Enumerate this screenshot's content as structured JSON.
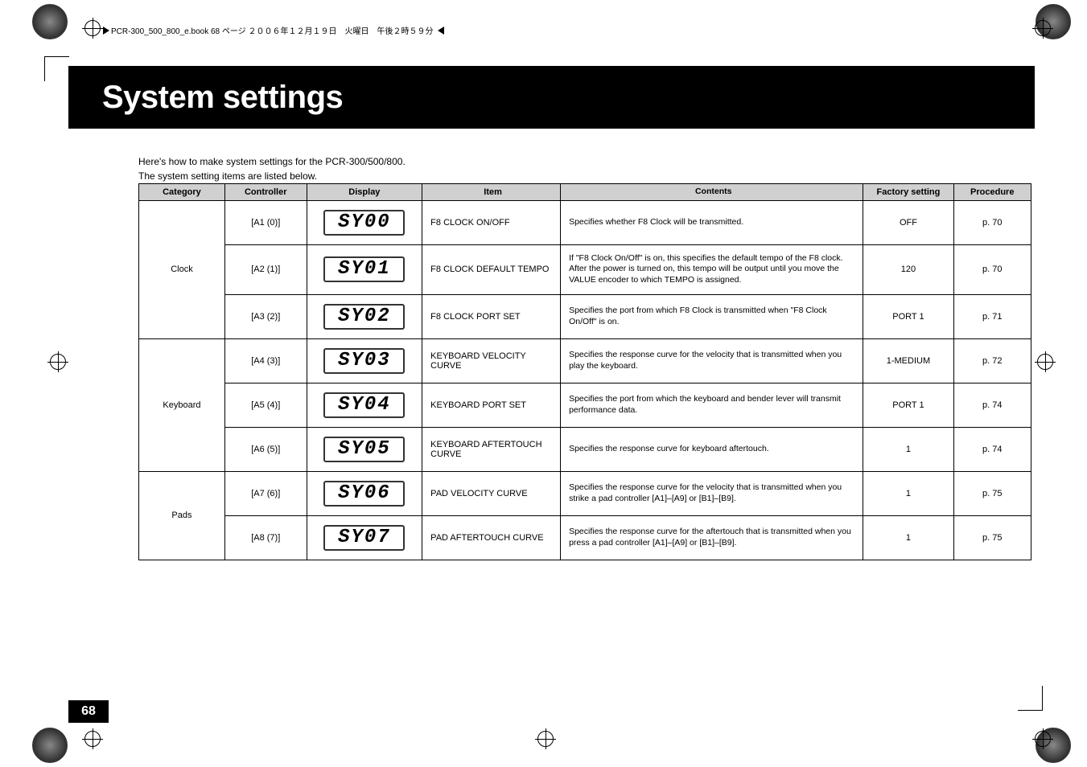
{
  "file_header": "PCR-300_500_800_e.book 68 ページ ２００６年１２月１９日　火曜日　午後２時５９分",
  "title": "System settings",
  "intro_line1": "Here's how to make system settings for the PCR-300/500/800.",
  "intro_line2": "The system setting items are listed below.",
  "page_number": "68",
  "headers": {
    "category": "Category",
    "controller": "Controller",
    "display": "Display",
    "item": "Item",
    "contents": "Contents",
    "factory": "Factory setting",
    "procedure": "Procedure"
  },
  "categories": {
    "clock": "Clock",
    "keyboard": "Keyboard",
    "pads": "Pads"
  },
  "rows": [
    {
      "controller": "[A1 (0)]",
      "display": "SY00",
      "item": "F8 CLOCK ON/OFF",
      "contents": "Specifies whether F8 Clock will be transmitted.",
      "factory": "OFF",
      "procedure": "p. 70"
    },
    {
      "controller": "[A2 (1)]",
      "display": "SY01",
      "item": "F8 CLOCK DEFAULT TEMPO",
      "contents": "If \"F8 Clock On/Off\" is on, this specifies the default tempo of the F8 clock. After the power is turned on, this tempo will be output until you move the VALUE encoder to which TEMPO is assigned.",
      "factory": "120",
      "procedure": "p. 70"
    },
    {
      "controller": "[A3 (2)]",
      "display": "SY02",
      "item": "F8 CLOCK PORT SET",
      "contents": "Specifies the port from which F8 Clock is transmitted when \"F8 Clock On/Off\" is on.",
      "factory": "PORT 1",
      "procedure": "p. 71"
    },
    {
      "controller": "[A4 (3)]",
      "display": "SY03",
      "item": "KEYBOARD VELOCITY CURVE",
      "contents": "Specifies the response curve for the velocity that is transmitted when you play the keyboard.",
      "factory": "1-MEDIUM",
      "procedure": "p. 72"
    },
    {
      "controller": "[A5 (4)]",
      "display": "SY04",
      "item": "KEYBOARD PORT SET",
      "contents": "Specifies the port from which the keyboard and bender lever will transmit performance data.",
      "factory": "PORT 1",
      "procedure": "p. 74"
    },
    {
      "controller": "[A6 (5)]",
      "display": "SY05",
      "item": "KEYBOARD AFTERTOUCH CURVE",
      "contents": "Specifies the response curve for keyboard aftertouch.",
      "factory": "1",
      "procedure": "p. 74"
    },
    {
      "controller": "[A7 (6)]",
      "display": "SY06",
      "item": "PAD VELOCITY CURVE",
      "contents": "Specifies the response curve for the velocity that is transmitted when you strike a pad controller [A1]–[A9] or [B1]–[B9].",
      "factory": "1",
      "procedure": "p. 75"
    },
    {
      "controller": "[A8 (7)]",
      "display": "SY07",
      "item": "PAD AFTERTOUCH CURVE",
      "contents": "Specifies the response curve for the aftertouch that is transmitted when you press a pad controller [A1]–[A9] or [B1]–[B9].",
      "factory": "1",
      "procedure": "p. 75"
    }
  ]
}
